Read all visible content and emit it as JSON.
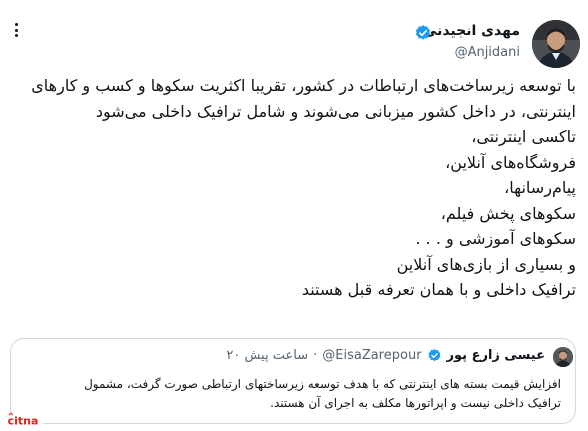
{
  "author": {
    "name": "مهدی انجیدنی",
    "handle": "@Anjidani",
    "avatar": "avatar-photo"
  },
  "menu": {
    "icon": "more-options-icon"
  },
  "tweet": {
    "lines": [
      "با توسعه زیرساخت‌های ارتباطات در کشور، تقریبا اکثریت سکوها و کسب و کارهای",
      "اینترنتی، در داخل کشور میزبانی می‌شوند و شامل ترافیک داخلی می‌شود",
      "تاکسی اینترنتی،",
      "فروشگاه‌های آنلاین،",
      "پیام‌رسانها،",
      "سکوهای پخش فیلم،",
      "سکوهای آموزشی و . . .",
      "و بسیاری از بازی‌های آنلاین",
      "ترافیک داخلی و با همان تعرفه قبل هستند"
    ]
  },
  "quote": {
    "name": "عیسی زارع پور",
    "handle": "@EisaZarepour",
    "separator": "·",
    "time": "۲۰ ساعت پیش",
    "lines": [
      "افزایش قیمت بسته های اینترنتی که با هدف توسعه زیرساختهای ارتباطی صورت گرفت، مشمول",
      "ترافیک داخلی نیست و اپراتورها مکلف به اجرای آن هستند."
    ]
  },
  "watermark": {
    "text": "citna"
  },
  "colors": {
    "verified": "#1d9bf0",
    "secondary_text": "#536471",
    "watermark": "#e2231a"
  }
}
